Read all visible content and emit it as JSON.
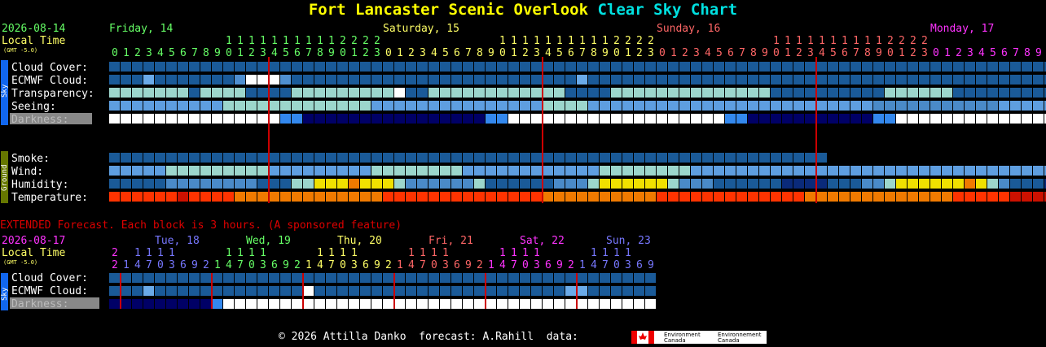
{
  "title": {
    "name": "Fort Lancaster Scenic Overlook",
    "word1": "Clear",
    "word2": "Sky",
    "word3": "Chart"
  },
  "date_label": "2026-08-14",
  "local_time_label": "Local Time",
  "gmt_label": "(GMT -5.0)",
  "days": [
    {
      "label": "Friday, 14",
      "color": "#66ff66"
    },
    {
      "label": "Saturday, 15",
      "color": "#ffff66"
    },
    {
      "label": "Sunday, 16",
      "color": "#ff6666"
    },
    {
      "label": "Monday, 17",
      "color": "#ff33ff"
    }
  ],
  "hour_tens": "111111111122222",
  "hour_ones": "012345678901230",
  "row_labels": {
    "cloud": "Cloud Cover:",
    "ecmwf": "ECMWF Cloud:",
    "transp": "Transparency:",
    "seeing": "Seeing:",
    "dark": "Darkness:",
    "smoke": "Smoke:",
    "wind": "Wind:",
    "humid": "Humidity:",
    "temp": "Temperature:"
  },
  "side_tabs": {
    "sky": "Sky",
    "ground": "Ground",
    "sky2": "Sky"
  },
  "extended_text": "EXTENDED Forecast. Each block is 3 hours. (A sponsored feature)",
  "ext_date_label": "2026-08-17",
  "ext_days": [
    {
      "label": "Tue, 18",
      "color": "#7777ff"
    },
    {
      "label": "Wed, 19",
      "color": "#66ff66"
    },
    {
      "label": "Thu, 20",
      "color": "#ffff66"
    },
    {
      "label": "Fri, 21",
      "color": "#ff6666"
    },
    {
      "label": "Sat, 22",
      "color": "#ff33ff"
    },
    {
      "label": "Sun, 23",
      "color": "#7777ff"
    }
  ],
  "ext_hour_tens": "2 1111 1111 1111 1111 1111 1111",
  "ext_hour_ones": "214703692147036921470369214703692147036921470369",
  "footer": "© 2026 Attilla Danko  forecast: A.Rahill  data:",
  "footer_org_en": "Environment Canada",
  "footer_org_fr": "Environnement Canada",
  "colors": {
    "dark_blue": "#003f7f",
    "cloud_blue": "#135a9a",
    "mid_blue": "#2c6eb0",
    "light_blue": "#4f8fd0",
    "pale_blue": "#63a2e2",
    "cyan": "#99ddcc",
    "white": "#ffffff",
    "red_line": "#cc0000"
  },
  "chart_data": {
    "type": "heatmap",
    "title": "Fort Lancaster Scenic Overlook Clear Sky Chart",
    "start_hour": 0,
    "hours": 84,
    "rows": {
      "cloud": "BBBBBBBBBBBBBBBBBBBBBBBBBBBBBBBBBBBBBBBBBBBBBBBBBBBBBBBBBBBBBBBBBBBBBBBBBBBBBBBBBBBB",
      "ecmwf": "BBBPBBBBBBBSWWWSBBBBBBBBBBBBBBBBBBBBBBBBBPBBBBBBBBBBBBBBBBBBBBBBBBBBBBBBBBBBBBBBBBBB",
      "transp": "CCCCCCCBCCCCBBBBCCCCCCCCCWBBCCCCCCCCCCCCBBBBCCCCCCCCCCCCCCBBBBBBBBBBCCCCCCBBBBBBBBBC",
      "seeing": "LLLLLLLLLLCCCCCCCCCCCCCLLLLLLLLLLLLLLLCCCCLLLLLLLLLLLLLLLLLLLLLLLLLMMMMMMMMMMMLLLLLLL",
      "dark": "WWWWWWWWWWWWWWWBBNNNNNNNNNNNNNNNNBBWWWWWWWWWWWWWWWWWWWBBNNNNNNNNNNNBBWWWWWWWWWWWWWWW",
      "smoke": "BBBBBBBBBBBBBBBBBBBBBBBBBBBBBBBBBBBBBBBBBBBBBBBBBBBBBBBBBBBBBBB",
      "wind": "LLLLLCCCCCCCCCLLLLLLLLLCCCCCCCCLLLLLLLLLLLLCCCCCCCCLLLLLLLLLLLLLLLLLLLLLLLLLLLLLLLLL",
      "humid": "BBBBBMMMMMMMMBBBCCYYYOYYYCMMMMMMCBBBBBBMMMCYYYYYYCMMMBBBBBBNNNNBBBMMCYYYYYYOYCMBBBNNB",
      "temp": "RRRRRRDRRRROOOOOOOOOOOOORRRRRRRRRRRRRROOOOOOOOOORRRRRRRRRRRRROOOOOOOOOOOOORRRRRDDDDD"
    },
    "ext_rows": {
      "cloud": "BBBBBBBBBBBBBBBBBBBBBBBBBBBBBBBBBBBBBBBBBBBBBBBB",
      "ecmwf": "BBBPBBBBBBBBBBBBBWBBBBBBBBBBBBBBBBBBBBBBPPBBBBBBBBB",
      "dark": "NNNNNNNNNBWWWWWWWWWWWWWWWWWWWWWWWWWWWWWWWWWWWWWWWWB"
    }
  }
}
